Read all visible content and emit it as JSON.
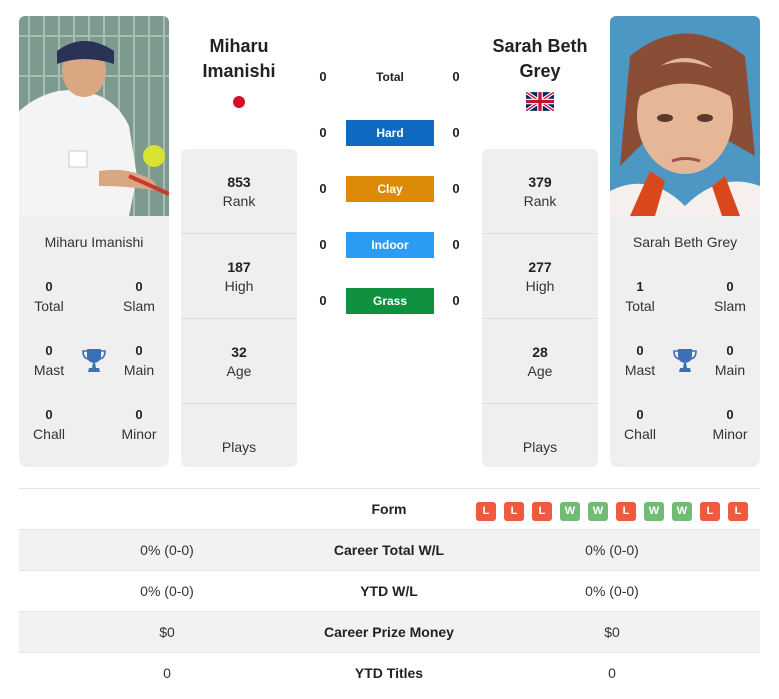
{
  "players": {
    "left": {
      "name": "Miharu Imanishi",
      "name_line1": "Miharu",
      "name_line2": "Imanishi",
      "flag": "japan-flag",
      "photo": "player-photo-miharu-imanishi",
      "titles": {
        "total": {
          "value": "0",
          "label": "Total"
        },
        "slam": {
          "value": "0",
          "label": "Slam"
        },
        "mast": {
          "value": "0",
          "label": "Mast"
        },
        "main": {
          "value": "0",
          "label": "Main"
        },
        "chall": {
          "value": "0",
          "label": "Chall"
        },
        "minor": {
          "value": "0",
          "label": "Minor"
        }
      },
      "stats": {
        "rank": {
          "value": "853",
          "label": "Rank"
        },
        "high": {
          "value": "187",
          "label": "High"
        },
        "age": {
          "value": "32",
          "label": "Age"
        },
        "plays": {
          "value": "",
          "label": "Plays"
        }
      }
    },
    "right": {
      "name": "Sarah Beth Grey",
      "name_line1": "Sarah Beth",
      "name_line2": "Grey",
      "flag": "uk-flag",
      "photo": "player-photo-sarah-beth-grey",
      "titles": {
        "total": {
          "value": "1",
          "label": "Total"
        },
        "slam": {
          "value": "0",
          "label": "Slam"
        },
        "mast": {
          "value": "0",
          "label": "Mast"
        },
        "main": {
          "value": "0",
          "label": "Main"
        },
        "chall": {
          "value": "0",
          "label": "Chall"
        },
        "minor": {
          "value": "0",
          "label": "Minor"
        }
      },
      "stats": {
        "rank": {
          "value": "379",
          "label": "Rank"
        },
        "high": {
          "value": "277",
          "label": "High"
        },
        "age": {
          "value": "28",
          "label": "Age"
        },
        "plays": {
          "value": "",
          "label": "Plays"
        }
      }
    }
  },
  "h2h_surfaces": [
    {
      "label": "Total",
      "left": "0",
      "right": "0",
      "color": ""
    },
    {
      "label": "Hard",
      "left": "0",
      "right": "0",
      "color": "#0e6bc1"
    },
    {
      "label": "Clay",
      "left": "0",
      "right": "0",
      "color": "#dd8a08"
    },
    {
      "label": "Indoor",
      "left": "0",
      "right": "0",
      "color": "#2b9cf2"
    },
    {
      "label": "Grass",
      "left": "0",
      "right": "0",
      "color": "#109140"
    }
  ],
  "comparison": {
    "form_label": "Form",
    "right_form": [
      "L",
      "L",
      "L",
      "W",
      "W",
      "L",
      "W",
      "W",
      "L",
      "L"
    ],
    "rows": [
      {
        "label": "Career Total W/L",
        "left": "0% (0-0)",
        "right": "0% (0-0)"
      },
      {
        "label": "YTD W/L",
        "left": "0% (0-0)",
        "right": "0% (0-0)"
      },
      {
        "label": "Career Prize Money",
        "left": "$0",
        "right": "$0"
      },
      {
        "label": "YTD Titles",
        "left": "0",
        "right": "0"
      }
    ]
  },
  "colors": {
    "trophy": "#3b6fb6",
    "win": "#72bb72",
    "loss": "#ee5b41"
  }
}
